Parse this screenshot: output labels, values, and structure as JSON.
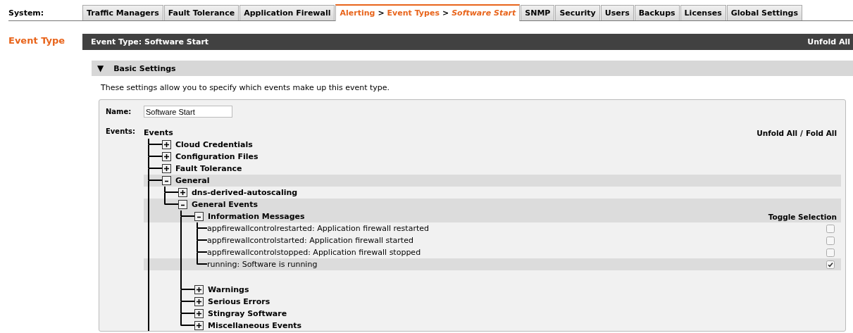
{
  "system_label": "System:",
  "tabs": [
    {
      "label": "Traffic Managers",
      "selected": false
    },
    {
      "label": "Fault Tolerance",
      "selected": false
    },
    {
      "label": "Application Firewall",
      "selected": false
    },
    {
      "selected": true,
      "crumbs": [
        {
          "text": "Alerting",
          "kind": "link"
        },
        {
          "text": ">",
          "kind": "separator"
        },
        {
          "text": "Event Types",
          "kind": "link"
        },
        {
          "text": ">",
          "kind": "separator"
        },
        {
          "text": "Software Start",
          "kind": "current"
        }
      ]
    },
    {
      "label": "SNMP",
      "selected": false
    },
    {
      "label": "Security",
      "selected": false
    },
    {
      "label": "Users",
      "selected": false
    },
    {
      "label": "Backups",
      "selected": false
    },
    {
      "label": "Licenses",
      "selected": false
    },
    {
      "label": "Global Settings",
      "selected": false
    }
  ],
  "page_heading": "Event Type",
  "header_bar": {
    "title": "Event Type: Software Start",
    "unfold_all": "Unfold All"
  },
  "section": {
    "toggle": "▼",
    "title": "Basic Settings",
    "description": "These settings allow you to specify which events make up this event type."
  },
  "form": {
    "name_label": "Name:",
    "name_value": "Software Start",
    "events_label": "Events:"
  },
  "tree": {
    "root": "Events",
    "unfold_all": "Unfold All",
    "fold_separator": "/",
    "fold_all": "Fold All",
    "more_below": true,
    "children": [
      {
        "label": "Cloud Credentials",
        "expanded": false
      },
      {
        "label": "Configuration Files",
        "expanded": false
      },
      {
        "label": "Fault Tolerance",
        "expanded": false
      },
      {
        "label": "General",
        "expanded": true,
        "children": [
          {
            "label": "dns-derived-autoscaling",
            "expanded": false
          },
          {
            "label": "General Events",
            "expanded": true,
            "children": [
              {
                "label": "Information Messages",
                "expanded": true,
                "toggle_label": "Toggle Selection",
                "children": [
                  {
                    "kind": "leaf",
                    "label": "appfirewallcontrolrestarted: Application firewall restarted",
                    "checked": false
                  },
                  {
                    "kind": "leaf",
                    "label": "appfirewallcontrolstarted: Application firewall started",
                    "checked": false
                  },
                  {
                    "kind": "leaf",
                    "label": "appfirewallcontrolstopped: Application firewall stopped",
                    "checked": false
                  },
                  {
                    "kind": "leaf",
                    "label": "running: Software is running",
                    "checked": true
                  }
                ]
              },
              {
                "label": "Warnings",
                "expanded": false
              },
              {
                "label": "Serious Errors",
                "expanded": false
              },
              {
                "label": "Stingray Software",
                "expanded": false
              },
              {
                "label": "Miscellaneous Events",
                "expanded": false
              }
            ]
          }
        ]
      }
    ]
  }
}
